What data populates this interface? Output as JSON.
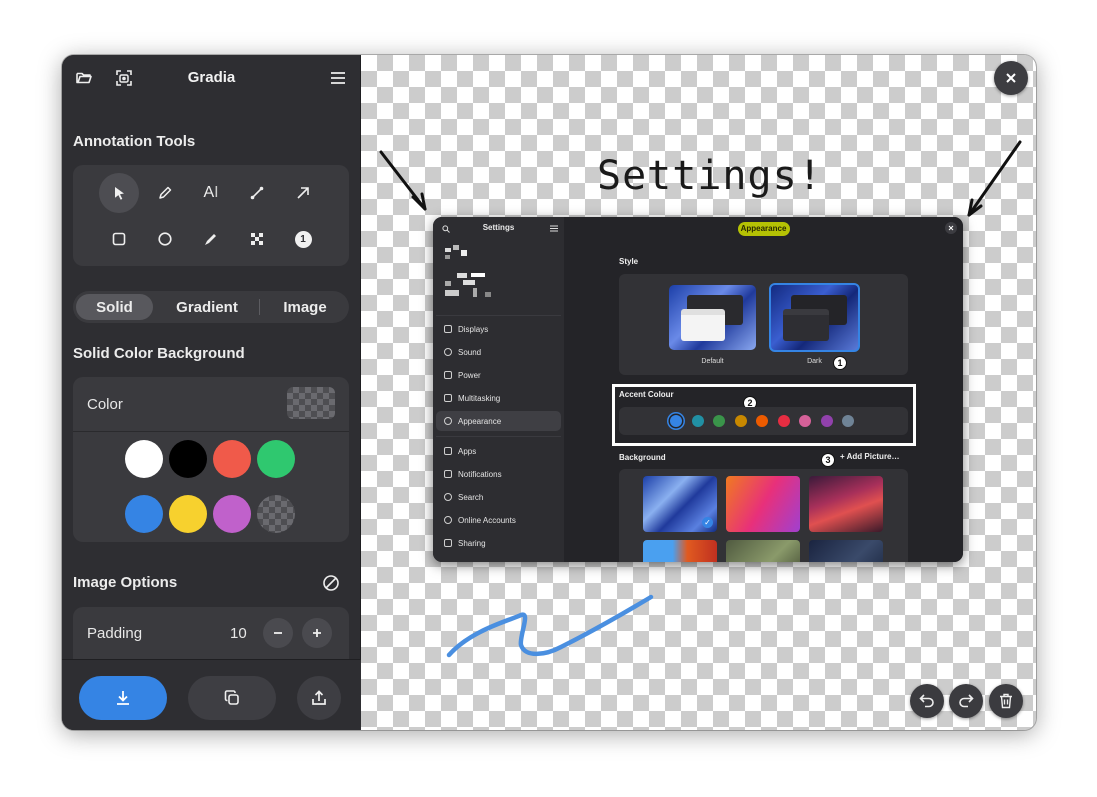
{
  "app": {
    "title": "Gradia"
  },
  "sidebar": {
    "annotation_title": "Annotation Tools",
    "tools": [
      "select-tool",
      "pen-tool",
      "text-tool",
      "line-tool",
      "arrow-tool",
      "rectangle-tool",
      "circle-tool",
      "highlighter-tool",
      "pixelate-tool",
      "number-tool"
    ],
    "number_tool_label": "1",
    "text_tool_label": "A",
    "background_tabs": [
      {
        "label": "Solid",
        "active": true
      },
      {
        "label": "Gradient",
        "active": false
      },
      {
        "label": "Image",
        "active": false
      }
    ],
    "solid_title": "Solid Color Background",
    "color_label": "Color",
    "swatches": [
      "#ffffff",
      "#000000",
      "#f05a4a",
      "#2fc86f",
      "#3584e4",
      "#f7d12e",
      "#c061cb",
      "transparent"
    ],
    "image_options_title": "Image Options",
    "padding_label": "Padding",
    "padding_value": "10"
  },
  "canvas": {
    "caption": "Settings!",
    "accent_colors": {
      "arrow": "#111111",
      "squiggle": "#4a8fe0",
      "highlight": "#d2e000",
      "box": "#ffffff"
    }
  },
  "screenshot": {
    "title": "Settings",
    "page_title": "Appearance",
    "nav_items": [
      {
        "label": "Displays",
        "active": false
      },
      {
        "label": "Sound",
        "active": false
      },
      {
        "label": "Power",
        "active": false
      },
      {
        "label": "Multitasking",
        "active": false
      },
      {
        "label": "Appearance",
        "active": true
      },
      {
        "label": "Apps",
        "active": false
      },
      {
        "label": "Notifications",
        "active": false
      },
      {
        "label": "Search",
        "active": false
      },
      {
        "label": "Online Accounts",
        "active": false
      },
      {
        "label": "Sharing",
        "active": false
      }
    ],
    "style_label": "Style",
    "style_default": "Default",
    "style_dark": "Dark",
    "accent_label": "Accent Colour",
    "accent_dots": [
      "#3584e4",
      "#2190a4",
      "#3a944a",
      "#c88800",
      "#ed5b00",
      "#e62d42",
      "#d56199",
      "#9141ac",
      "#6f8396"
    ],
    "background_label": "Background",
    "add_picture": "Add Picture…",
    "badges": [
      "1",
      "2",
      "3"
    ]
  }
}
